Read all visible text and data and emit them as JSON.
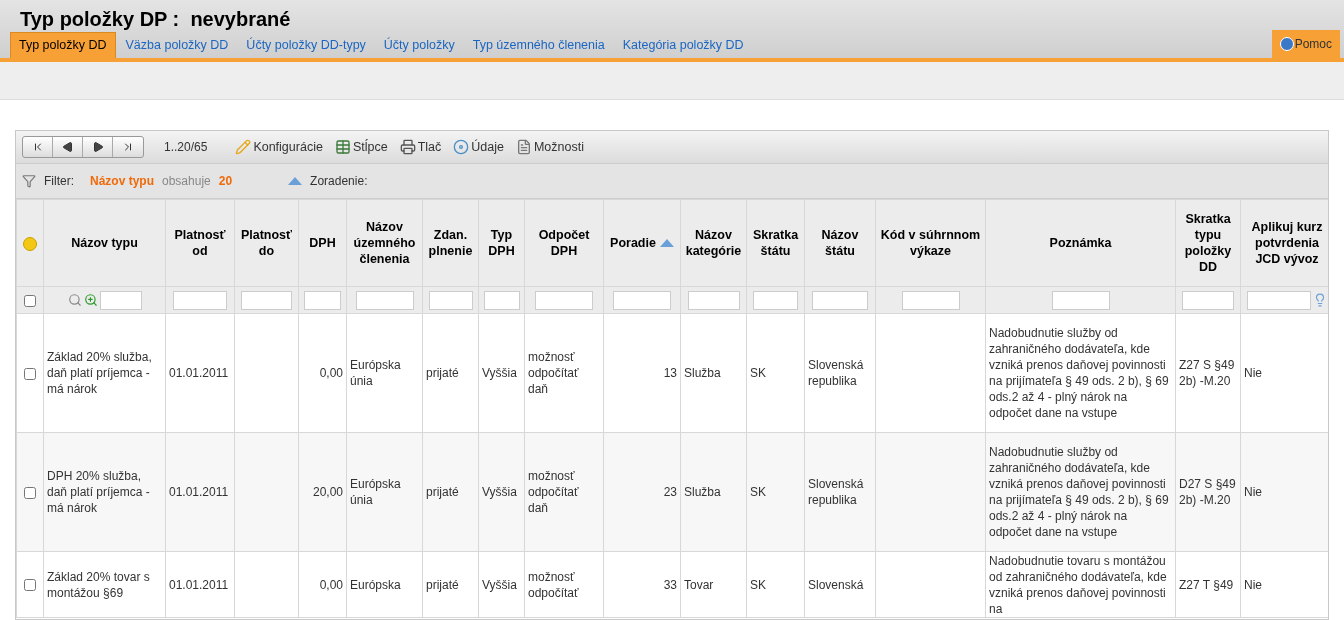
{
  "title": "Typ položky DP :  nevybrané",
  "tabs": [
    {
      "label": "Typ položky DD",
      "selected": true
    },
    {
      "label": "Väzba položky DD",
      "selected": false
    },
    {
      "label": "Účty položky DD-typy",
      "selected": false
    },
    {
      "label": "Účty položky",
      "selected": false
    },
    {
      "label": "Typ územného členenia",
      "selected": false
    },
    {
      "label": "Kategória položky DD",
      "selected": false
    }
  ],
  "help": "Pomoc",
  "toolbar": {
    "range": "1..20/65",
    "tools": [
      {
        "kind": "config",
        "label": "Konfigurácie"
      },
      {
        "kind": "columns",
        "label": "Stĺpce"
      },
      {
        "kind": "print",
        "label": "Tlač"
      },
      {
        "kind": "data",
        "label": "Údaje"
      },
      {
        "kind": "options",
        "label": "Možnosti"
      }
    ]
  },
  "filter": {
    "label": "Filter:",
    "field": "Názov typu",
    "operator": "obsahuje",
    "value": "20",
    "sort_label": "Zoradenie:"
  },
  "table": {
    "select_all_checked": false,
    "columns": [
      {
        "label": "Názov typu",
        "sorted": false
      },
      {
        "label": "Platnosť od",
        "sorted": false
      },
      {
        "label": "Platnosť do",
        "sorted": false
      },
      {
        "label": "DPH",
        "sorted": false
      },
      {
        "label": "Názov územného členenia",
        "sorted": false
      },
      {
        "label": "Zdan. plnenie",
        "sorted": false
      },
      {
        "label": "Typ DPH",
        "sorted": false
      },
      {
        "label": "Odpočet DPH",
        "sorted": false
      },
      {
        "label": "Poradie",
        "sorted": true
      },
      {
        "label": "Názov kategórie",
        "sorted": false
      },
      {
        "label": "Skratka štátu",
        "sorted": false
      },
      {
        "label": "Názov štátu",
        "sorted": false
      },
      {
        "label": "Kód v súhrnnom výkaze",
        "sorted": false
      },
      {
        "label": "Poznámka",
        "sorted": false
      },
      {
        "label": "Skratka typu položky DD",
        "sorted": false
      },
      {
        "label": "Aplikuj kurz potvrdenia JCD vývoz",
        "sorted": false
      }
    ],
    "rows": [
      {
        "checked": false,
        "cells": [
          "Základ 20% služba, daň platí príjemca - má nárok",
          "01.01.2011",
          "",
          "0,00",
          "Európska únia",
          "prijaté",
          "Vyššia",
          "možnosť odpočítať daň",
          "13",
          "Služba",
          "SK",
          "Slovenská republika",
          "",
          "Nadobudnutie služby od zahraničného dodávateľa, kde vzniká prenos daňovej povinnosti na prijímateľa § 49 ods. 2 b), § 69 ods.2 až 4 - plný nárok na odpočet dane na vstupe",
          "Z27 S §49 2b) -M.20",
          "Nie"
        ]
      },
      {
        "checked": false,
        "cells": [
          "DPH 20% služba, daň platí príjemca - má nárok",
          "01.01.2011",
          "",
          "20,00",
          "Európska únia",
          "prijaté",
          "Vyššia",
          "možnosť odpočítať daň",
          "23",
          "Služba",
          "SK",
          "Slovenská republika",
          "",
          "Nadobudnutie služby od zahraničného dodávateľa, kde vzniká prenos daňovej povinnosti na prijímateľa § 49 ods. 2 b), § 69 ods.2 až 4 - plný nárok na odpočet dane na vstupe",
          "D27 S §49 2b) -M.20",
          "Nie"
        ]
      },
      {
        "checked": false,
        "cells": [
          "Základ 20% tovar s montážou §69",
          "01.01.2011",
          "",
          "0,00",
          "Európska",
          "prijaté",
          "Vyššia",
          "možnosť odpočítať",
          "33",
          "Tovar",
          "SK",
          "Slovenská",
          "",
          "Nadobudnutie tovaru s montážou od zahraničného dodávateľa, kde vzniká prenos daňovej povinnosti na",
          "Z27 T §49",
          "Nie"
        ]
      }
    ]
  }
}
